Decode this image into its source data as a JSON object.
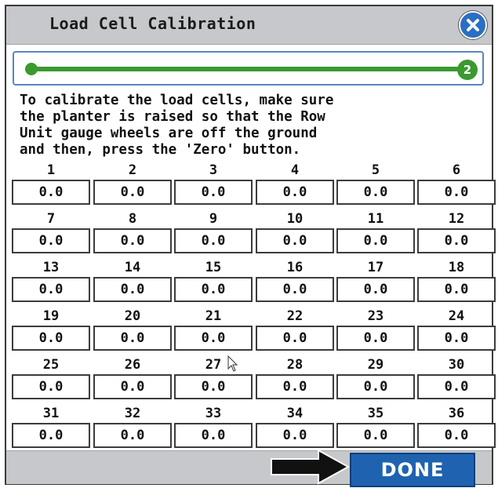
{
  "dialog": {
    "title": "Load Cell Calibration",
    "close_icon": "close-icon"
  },
  "progress": {
    "step_label": "2",
    "fraction": 1.0,
    "color": "#3a9a2f"
  },
  "instructions": {
    "lines": [
      "To calibrate the load cells, make sure",
      "the planter is raised so that the Row",
      "Unit gauge wheels are off the ground",
      "and then, press the 'Zero' button."
    ]
  },
  "cells": [
    {
      "label": "1",
      "value": "0.0"
    },
    {
      "label": "2",
      "value": "0.0"
    },
    {
      "label": "3",
      "value": "0.0"
    },
    {
      "label": "4",
      "value": "0.0"
    },
    {
      "label": "5",
      "value": "0.0"
    },
    {
      "label": "6",
      "value": "0.0"
    },
    {
      "label": "7",
      "value": "0.0"
    },
    {
      "label": "8",
      "value": "0.0"
    },
    {
      "label": "9",
      "value": "0.0"
    },
    {
      "label": "10",
      "value": "0.0"
    },
    {
      "label": "11",
      "value": "0.0"
    },
    {
      "label": "12",
      "value": "0.0"
    },
    {
      "label": "13",
      "value": "0.0"
    },
    {
      "label": "14",
      "value": "0.0"
    },
    {
      "label": "15",
      "value": "0.0"
    },
    {
      "label": "16",
      "value": "0.0"
    },
    {
      "label": "17",
      "value": "0.0"
    },
    {
      "label": "18",
      "value": "0.0"
    },
    {
      "label": "19",
      "value": "0.0"
    },
    {
      "label": "20",
      "value": "0.0"
    },
    {
      "label": "21",
      "value": "0.0"
    },
    {
      "label": "22",
      "value": "0.0"
    },
    {
      "label": "23",
      "value": "0.0"
    },
    {
      "label": "24",
      "value": "0.0"
    },
    {
      "label": "25",
      "value": "0.0"
    },
    {
      "label": "26",
      "value": "0.0"
    },
    {
      "label": "27",
      "value": "0.0"
    },
    {
      "label": "28",
      "value": "0.0"
    },
    {
      "label": "29",
      "value": "0.0"
    },
    {
      "label": "30",
      "value": "0.0"
    },
    {
      "label": "31",
      "value": "0.0"
    },
    {
      "label": "32",
      "value": "0.0"
    },
    {
      "label": "33",
      "value": "0.0"
    },
    {
      "label": "34",
      "value": "0.0"
    },
    {
      "label": "35",
      "value": "0.0"
    },
    {
      "label": "36",
      "value": "0.0"
    }
  ],
  "footer": {
    "done_label": "DONE",
    "pointer_icon": "arrow-right-icon"
  },
  "colors": {
    "accent": "#1f63b0",
    "progress": "#3a9a2f",
    "header": "#c6c8cb"
  }
}
